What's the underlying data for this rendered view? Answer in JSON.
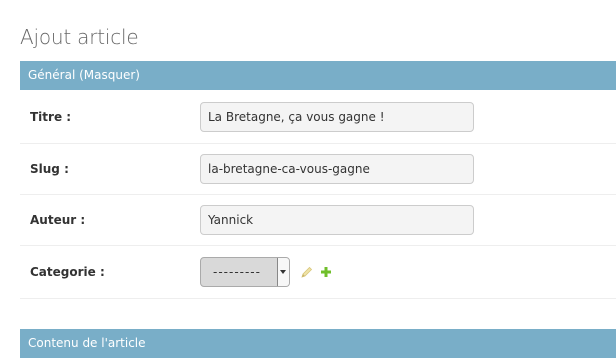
{
  "page": {
    "title": "Ajout article"
  },
  "fieldsets": {
    "general": {
      "title": "Général",
      "toggle": "(Masquer)"
    },
    "contenu": {
      "title": "Contenu de l'article"
    }
  },
  "fields": {
    "titre": {
      "label": "Titre :",
      "value": "La Bretagne, ça vous gagne !"
    },
    "slug": {
      "label": "Slug :",
      "value": "la-bretagne-ca-vous-gagne"
    },
    "auteur": {
      "label": "Auteur :",
      "value": "Yannick"
    },
    "categorie": {
      "label": "Categorie :",
      "selected": "---------"
    }
  },
  "icons": {
    "edit": "pencil-icon",
    "add": "plus-icon"
  },
  "colors": {
    "header_bg": "#79aec8",
    "add_icon": "#70bf2b",
    "edit_icon_disabled": "#e6d99a"
  }
}
